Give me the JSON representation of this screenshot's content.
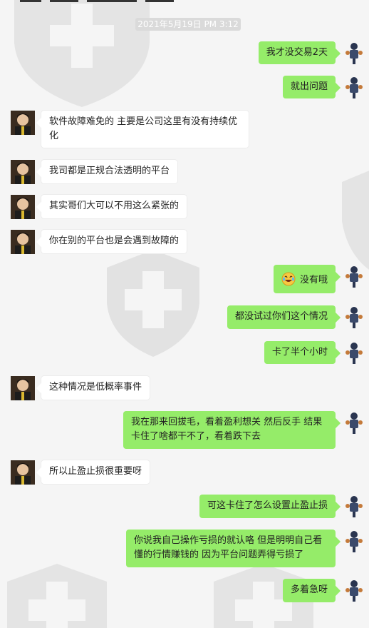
{
  "timestamp": "2021年5月19日 PM 3:12",
  "messages": [
    {
      "side": "out",
      "text": "我才没交易2天"
    },
    {
      "side": "out",
      "text": "就出问题"
    },
    {
      "side": "in",
      "text": "软件故障难免的 主要是公司这里有没有持续优化"
    },
    {
      "side": "in",
      "text": "我司都是正规合法透明的平台"
    },
    {
      "side": "in",
      "text": "其实哥们大可以不用这么紧张的"
    },
    {
      "side": "in",
      "text": "你在别的平台也是会遇到故障的"
    },
    {
      "side": "out",
      "emoji": "laughing-crying-emoji",
      "text": "没有哦"
    },
    {
      "side": "out",
      "text": "都没试过你们这个情况"
    },
    {
      "side": "out",
      "text": "卡了半个小时"
    },
    {
      "side": "in",
      "text": "这种情况是低概率事件"
    },
    {
      "side": "out",
      "text": "我在那来回拔毛，看着盈利想关 然后反手  结果卡住了啥都干不了，看着跌下去"
    },
    {
      "side": "in",
      "text": "所以止盈止损很重要呀"
    },
    {
      "side": "out",
      "text": "可这卡住了怎么设置止盈止损"
    },
    {
      "side": "out",
      "text": "你说我自己操作亏损的就认咯  但是明明自己看懂的行情赚钱的  因为平台问题弄得亏损了"
    },
    {
      "side": "out",
      "text": "多着急呀"
    }
  ],
  "colors": {
    "out_bubble": "#95ec69",
    "in_bubble": "#ffffff",
    "background": "#f5f5f5",
    "timestamp_bg": "#dadada"
  }
}
